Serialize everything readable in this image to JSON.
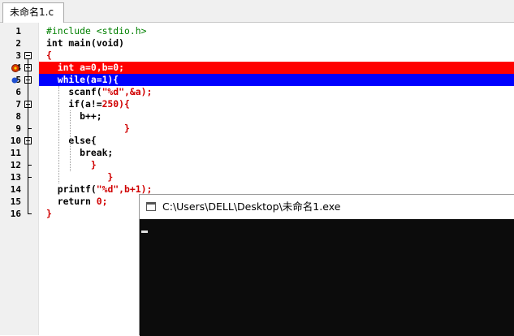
{
  "tab": {
    "label": "未命名1.c"
  },
  "lines": [
    {
      "n": "1",
      "segs": [
        {
          "t": "#include <stdio.h>",
          "c": "green"
        }
      ]
    },
    {
      "n": "2",
      "segs": [
        {
          "t": "int main(void)",
          "c": "black"
        }
      ]
    },
    {
      "n": "3",
      "segs": [
        {
          "t": "{",
          "c": "red"
        }
      ]
    },
    {
      "n": "4",
      "segs": [
        {
          "t": "  int a=0,b=0;",
          "c": "white"
        }
      ],
      "highlight": "red",
      "marker": "error"
    },
    {
      "n": "5",
      "segs": [
        {
          "t": "  while(a=1){",
          "c": "white"
        }
      ],
      "highlight": "blue",
      "marker": "breakpoint"
    },
    {
      "n": "6",
      "segs": [
        {
          "t": "    scanf(",
          "c": "black"
        },
        {
          "t": "\"%d\"",
          "c": "red"
        },
        {
          "t": ",&a);",
          "c": "red"
        }
      ]
    },
    {
      "n": "7",
      "segs": [
        {
          "t": "    if(a!=",
          "c": "black"
        },
        {
          "t": "250",
          "c": "red"
        },
        {
          "t": "){",
          "c": "red"
        }
      ]
    },
    {
      "n": "8",
      "segs": [
        {
          "t": "      b++;",
          "c": "black"
        }
      ]
    },
    {
      "n": "9",
      "segs": [
        {
          "t": "              }",
          "c": "red"
        }
      ]
    },
    {
      "n": "10",
      "segs": [
        {
          "t": "    else{",
          "c": "black"
        }
      ]
    },
    {
      "n": "11",
      "segs": [
        {
          "t": "      break;",
          "c": "black"
        }
      ]
    },
    {
      "n": "12",
      "segs": [
        {
          "t": "        }",
          "c": "red"
        }
      ]
    },
    {
      "n": "13",
      "segs": [
        {
          "t": "           }",
          "c": "red"
        }
      ]
    },
    {
      "n": "14",
      "segs": [
        {
          "t": "  printf(",
          "c": "black"
        },
        {
          "t": "\"%d\"",
          "c": "red"
        },
        {
          "t": ",b+1);",
          "c": "red"
        }
      ]
    },
    {
      "n": "15",
      "segs": [
        {
          "t": "  return ",
          "c": "black"
        },
        {
          "t": "0;",
          "c": "red"
        }
      ]
    },
    {
      "n": "16",
      "segs": [
        {
          "t": "}",
          "c": "red"
        }
      ]
    }
  ],
  "console": {
    "title": "C:\\Users\\DELL\\Desktop\\未命名1.exe"
  },
  "colors": {
    "error_highlight": "#ff0000",
    "current_line_highlight": "#0000ff",
    "console_bg": "#0c0c0c"
  },
  "icons": {
    "error_marker": "error-icon",
    "breakpoint_marker": "breakpoint-arrow-icon",
    "console_icon": "console-window-icon"
  }
}
